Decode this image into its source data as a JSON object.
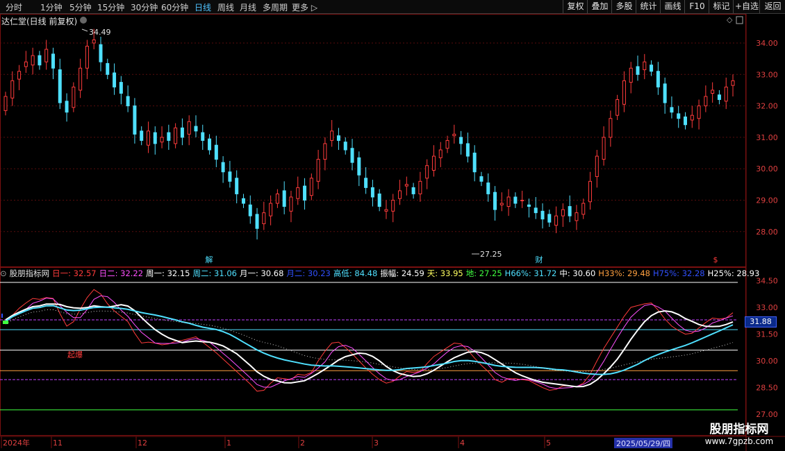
{
  "toolbar": {
    "periods": [
      "分时",
      "1分钟",
      "5分钟",
      "15分钟",
      "30分钟",
      "60分钟",
      "日线",
      "周线",
      "月线",
      "多周期",
      "更多 ▷"
    ],
    "active_period": "日线",
    "buttons": [
      "复权",
      "叠加",
      "多股",
      "统计",
      "画线",
      "F10",
      "标记",
      "+自选",
      "返回"
    ]
  },
  "chart": {
    "title": "达仁堂(日线 前复权)",
    "high_label": "34.49",
    "low_label": "27.25",
    "event_markers": [
      "解",
      "财",
      "$"
    ],
    "y_ticks": [
      "34.00",
      "33.00",
      "32.00",
      "31.00",
      "30.00",
      "29.00",
      "28.00"
    ]
  },
  "indicator": {
    "name": "股朋指标网",
    "values": [
      {
        "label": "日一: 32.57",
        "color": "#ff3b3b"
      },
      {
        "label": "日二: 32.22",
        "color": "#ff50ff"
      },
      {
        "label": "周一: 32.15",
        "color": "#ffffff"
      },
      {
        "label": "周二: 31.06",
        "color": "#4fe0ff"
      },
      {
        "label": "月一: 30.68",
        "color": "#ffffff"
      },
      {
        "label": "月二: 30.23",
        "color": "#3050ff"
      },
      {
        "label": "高低: 84.48",
        "color": "#4fe0ff"
      },
      {
        "label": "振幅: 24.59",
        "color": "#ffffff"
      },
      {
        "label": "天: 33.95",
        "color": "#ffff60"
      },
      {
        "label": "地: 27.25",
        "color": "#40ff40"
      },
      {
        "label": "H66%: 31.72",
        "color": "#4fe0ff"
      },
      {
        "label": "中: 30.60",
        "color": "#ffffff"
      },
      {
        "label": "H33%: 29.48",
        "color": "#ffa040"
      },
      {
        "label": "H75%: 32.28",
        "color": "#3050ff"
      },
      {
        "label": "H25%: 28.93",
        "color": "#ffffff"
      }
    ],
    "y_ticks": [
      "34.50",
      "33.00",
      "31.50",
      "30.00",
      "28.50",
      "27.00"
    ],
    "current_value": "31.88",
    "signal_label": "起爆"
  },
  "x_axis": {
    "labels": [
      "2024年",
      "11",
      "12",
      "1",
      "2",
      "3",
      "4",
      "5"
    ],
    "highlight_date": "2025/05/29/四"
  },
  "watermark": {
    "line1": "股朋指标网",
    "line2": "www.7gpzb.com"
  },
  "colors": {
    "up": "#ff3b3b",
    "down": "#4fe0ff",
    "background": "#000000"
  }
}
